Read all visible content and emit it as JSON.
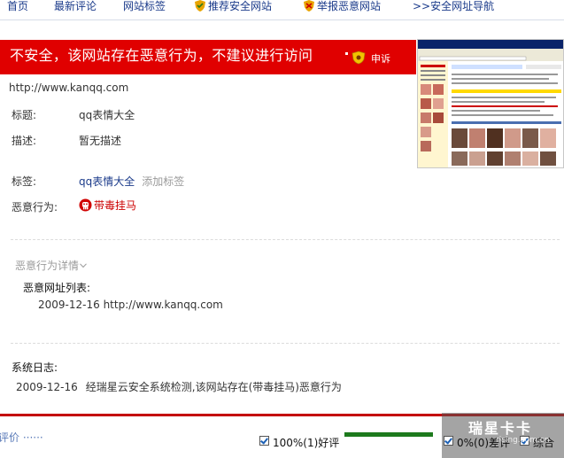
{
  "nav": {
    "items": [
      {
        "label": "首页"
      },
      {
        "label": "最新评论"
      },
      {
        "label": "网站标签"
      },
      {
        "label": "推荐安全网站"
      },
      {
        "label": "举报恶意网站"
      },
      {
        "label": ">>安全网址导航"
      }
    ]
  },
  "warning": {
    "text": "不安全，该网站存在恶意行为，不建议进行访问",
    "appeal": "申诉"
  },
  "site": {
    "url": "http://www.kanqq.com",
    "title_label": "标题:",
    "title_value": "qq表情大全",
    "desc_label": "描述:",
    "desc_value": "暂无描述",
    "tag_label": "标签:",
    "tag_value": "qq表情大全",
    "tag_add": "添加标签",
    "malicious_label": "恶意行为:",
    "malicious_value": "带毒挂马"
  },
  "details": {
    "toggle": "恶意行为详情",
    "list_title": "恶意网址列表:",
    "list": [
      {
        "date": "2009-12-16",
        "url": "http://www.kanqq.com"
      }
    ]
  },
  "log": {
    "title": "系统日志:",
    "entries": [
      {
        "date": "2009-12-16",
        "text": "经瑞星云安全系统检测,该网站存在(带毒挂马)恶意行为"
      }
    ]
  },
  "rating": {
    "title": "评价 ······",
    "good": "100%(1)好评",
    "bad": "0%(0)差评",
    "overall": "综合",
    "good_fraction": 1.0
  },
  "watermark": {
    "brand": "瑞星卡卡",
    "sub": "rising.com.cn"
  },
  "colors": {
    "warning_red": "#e00000",
    "link_blue": "#1a3a8a",
    "good_green": "#1d7a1d"
  }
}
